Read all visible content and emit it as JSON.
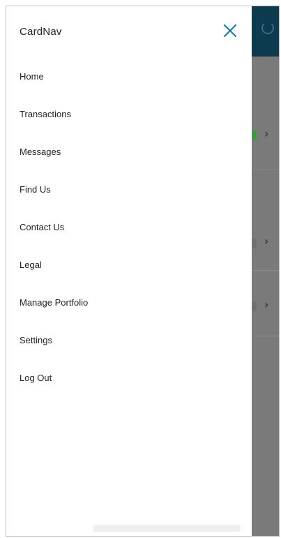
{
  "app": {
    "title": "CardNav"
  },
  "menu": {
    "items": [
      {
        "label": "Home"
      },
      {
        "label": "Transactions"
      },
      {
        "label": "Messages"
      },
      {
        "label": "Find Us"
      },
      {
        "label": "Contact Us"
      },
      {
        "label": "Legal"
      },
      {
        "label": "Manage Portfolio"
      },
      {
        "label": "Settings"
      },
      {
        "label": "Log Out"
      }
    ]
  },
  "icons": {
    "close": "close-icon",
    "refresh": "refresh-icon",
    "chevron": "chevron-right-icon"
  },
  "colors": {
    "header": "#0e3a4f",
    "close_icon": "#1a7fa8",
    "overlay": "#7a7a7a",
    "status_green": "#3c9a3c"
  }
}
